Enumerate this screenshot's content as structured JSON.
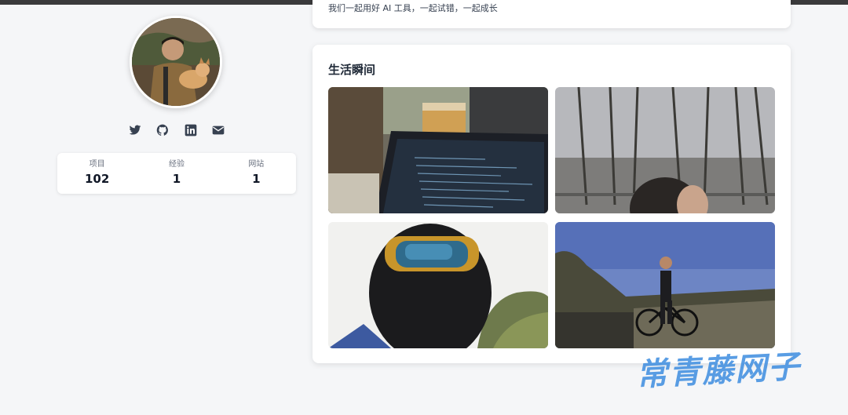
{
  "profile": {
    "avatar_alt": "avatar",
    "socials": [
      {
        "name": "twitter"
      },
      {
        "name": "github"
      },
      {
        "name": "linkedin"
      },
      {
        "name": "email"
      }
    ],
    "stats": [
      {
        "label": "项目",
        "value": "102"
      },
      {
        "label": "经验",
        "value": "1"
      },
      {
        "label": "网站",
        "value": "1"
      }
    ]
  },
  "intro": {
    "text": "我们一起用好 AI 工具，一起试错，一起成长"
  },
  "life": {
    "title": "生活瞬间",
    "photos": [
      {
        "subject": "laptop with code and drink on table"
      },
      {
        "subject": "tall trees and sky"
      },
      {
        "subject": "motorcycle helmet selfie"
      },
      {
        "subject": "man with bicycle on mountain"
      }
    ]
  },
  "watermark": {
    "text": "常青藤网子"
  },
  "colors": {
    "background": "#f5f6f8",
    "card": "#ffffff",
    "icon": "#374151",
    "watermark": "#3d8de0"
  }
}
